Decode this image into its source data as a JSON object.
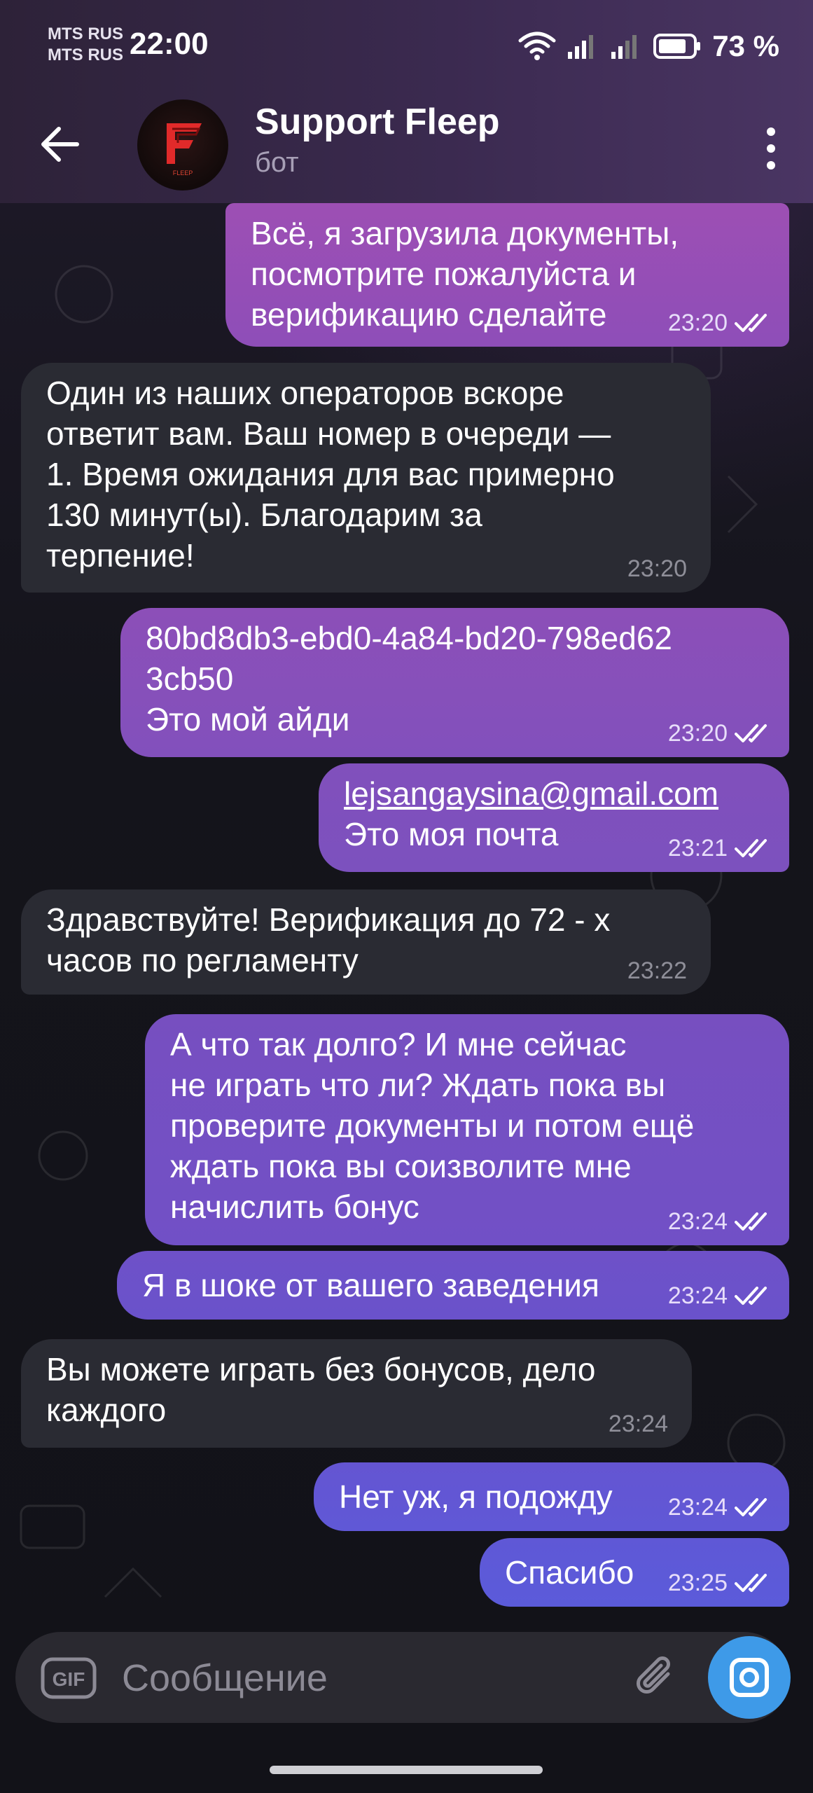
{
  "status_bar": {
    "carrier_1": "MTS RUS",
    "carrier_2": "MTS RUS",
    "time": "22:00",
    "battery": "73 %",
    "icons": [
      "wifi-icon",
      "signal-icon",
      "signal-icon",
      "battery-icon"
    ]
  },
  "header": {
    "back_icon": "arrow-left-icon",
    "avatar_logo_text": "FLEEP",
    "title": "Support Fleep",
    "subtitle": "бот",
    "menu_icon": "more-vertical-icon"
  },
  "messages": [
    {
      "direction": "out",
      "text": "Всё, я загрузила документы,\nпосмотрите пожалуйста и\nверификацию сделайте",
      "time": "23:20",
      "read": true
    },
    {
      "direction": "in",
      "text": "Один из наших операторов вскоре\nответит вам. Ваш номер в очереди —\n1. Время ожидания для вас примерно\n130 минут(ы). Благодарим за\nтерпение!",
      "time": "23:20"
    },
    {
      "direction": "out",
      "text": "80bd8db3-ebd0-4a84-bd20-798ed62\n3cb50\nЭто мой айди",
      "time": "23:20",
      "read": true
    },
    {
      "direction": "out",
      "link": "lejsangaysina@gmail.com",
      "text": "Это моя почта",
      "time": "23:21",
      "read": true
    },
    {
      "direction": "in",
      "text": "Здравствуйте! Верификация до 72 - х\nчасов по регламенту",
      "time": "23:22"
    },
    {
      "direction": "out",
      "text": "А что так долго? И мне сейчас\nне играть что ли? Ждать пока вы\nпроверите документы и потом ещё\nждать пока вы соизволите мне\nначислить бонус",
      "time": "23:24",
      "read": true
    },
    {
      "direction": "out",
      "text": "Я в шоке от вашего заведения",
      "time": "23:24",
      "read": true
    },
    {
      "direction": "in",
      "text": "Вы можете играть без бонусов, дело\nкаждого",
      "time": "23:24"
    },
    {
      "direction": "out",
      "text": "Нет уж, я подожду",
      "time": "23:24",
      "read": true
    },
    {
      "direction": "out",
      "text": "Спасибо",
      "time": "23:25",
      "read": true
    }
  ],
  "composer": {
    "gif_label": "GIF",
    "placeholder": "Сообщение",
    "attach_icon": "paperclip-icon",
    "camera_icon": "camera-icon"
  },
  "colors": {
    "incoming_bubble": "#2a2b33",
    "outgoing_top": "#9a4fb5",
    "outgoing_bottom": "#6a5ad8",
    "send_button": "#3e9ae8"
  }
}
